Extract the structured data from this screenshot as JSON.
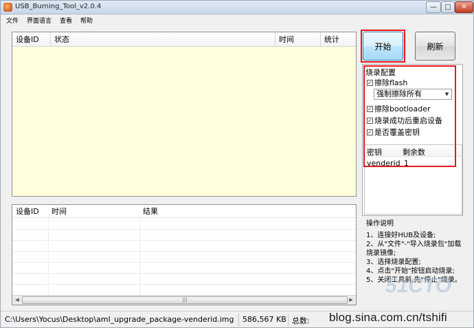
{
  "window": {
    "title": "USB_Burning_Tool_v2.0.4",
    "controls": {
      "minimize": "—",
      "maximize": "□",
      "close": "✕"
    }
  },
  "menu": [
    "文件",
    "界面语言",
    "查看",
    "帮助"
  ],
  "device_table": {
    "columns": [
      "设备ID",
      "状态",
      "时间",
      "统计"
    ],
    "rows": []
  },
  "result_table": {
    "columns": [
      "设备ID",
      "时间",
      "结果"
    ],
    "rows": []
  },
  "buttons": {
    "start": "开始",
    "refresh": "刷新"
  },
  "config": {
    "title": "烧录配置",
    "erase_flash": {
      "label": "擦除flash",
      "checked": true
    },
    "erase_mode": {
      "selected": "强制擦除所有"
    },
    "erase_bootloader": {
      "label": "擦除bootloader",
      "checked": true
    },
    "reboot_after": {
      "label": "烧录成功后重启设备",
      "checked": true
    },
    "overwrite_key": {
      "label": "是否覆盖密钥",
      "checked": true
    },
    "key_table": {
      "columns": [
        "密钥",
        "剩余数"
      ],
      "rows": [
        {
          "key": "venderid",
          "remaining": "1"
        }
      ]
    }
  },
  "instructions": {
    "title": "操作说明",
    "lines": [
      "1、连接好HUB及设备;",
      "2、从\"文件\"-\"导入烧录包\"加载烧录镜像;",
      "3、选择烧录配置;",
      "4、点击\"开始\"按钮启动烧录;",
      "5、关闭工具前,先\"停止\"烧录。"
    ]
  },
  "status_bar": {
    "path": "C:\\Users\\Yocus\\Desktop\\aml_upgrade_package-venderid.img",
    "size": "586,567 KB",
    "total_label": "总数:"
  },
  "watermark": {
    "text": "blog.sina.com.cn/tshifi",
    "faint": "51CTO"
  },
  "colors": {
    "highlight": "#e8161d",
    "grid_bg": "#ffffdc",
    "start_btn": "#bee6fd"
  }
}
